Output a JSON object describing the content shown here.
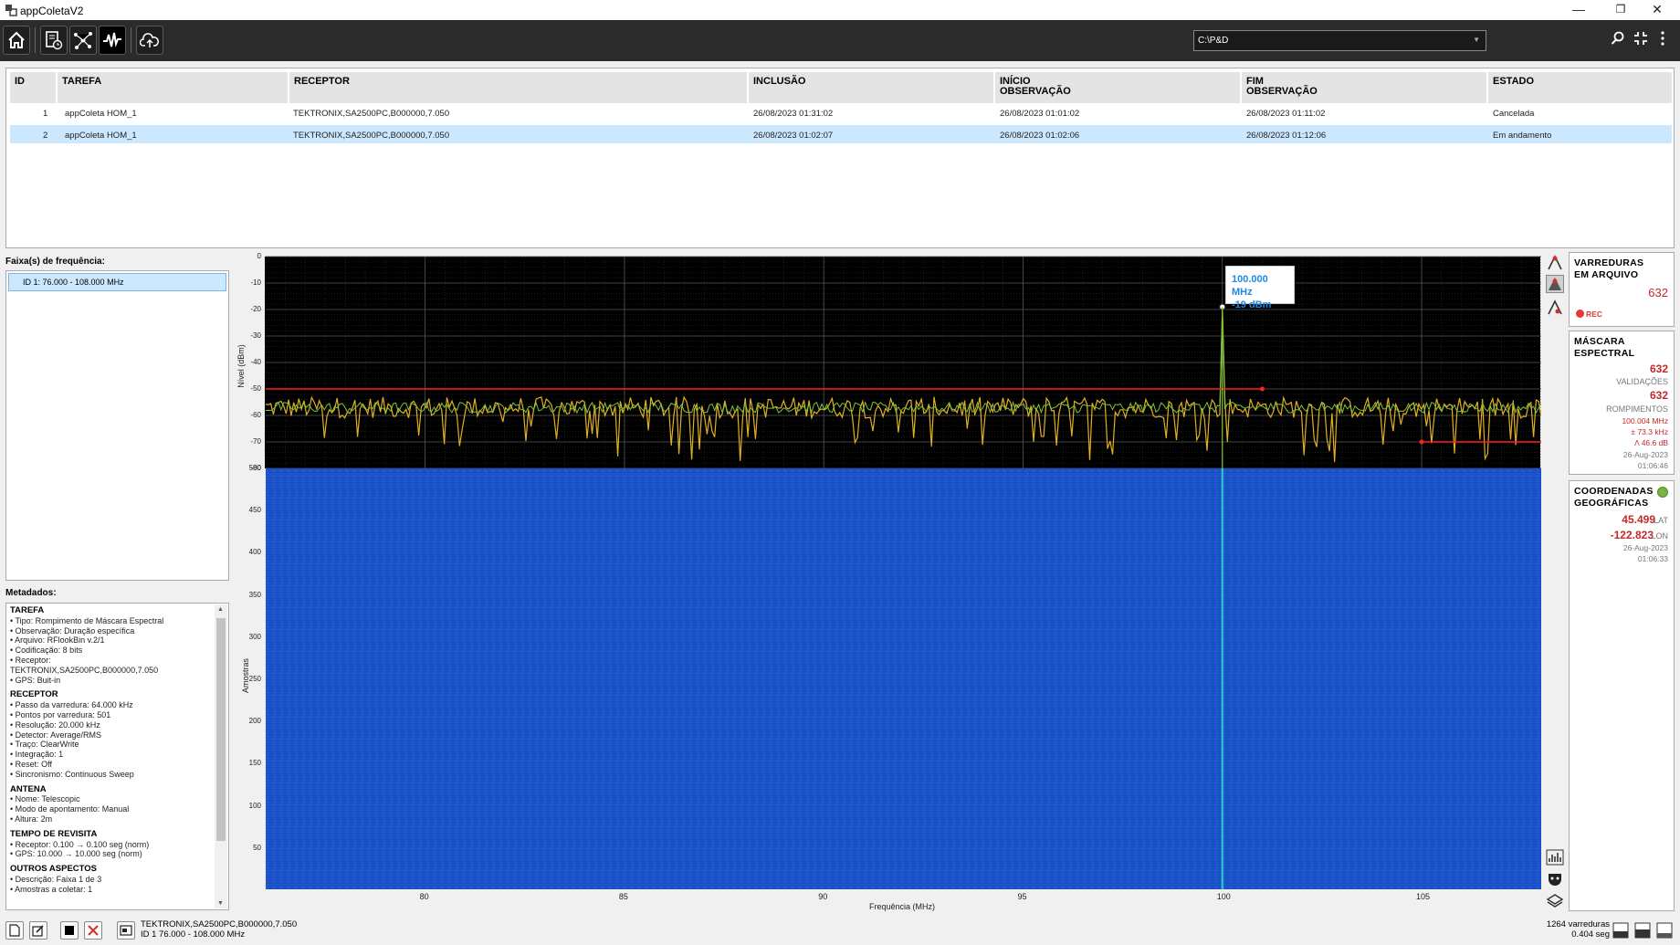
{
  "window": {
    "title": "appColetaV2",
    "controls": [
      "—",
      "❐",
      "✕"
    ]
  },
  "toolbar": {
    "path": "C:\\P&D"
  },
  "table": {
    "headers": [
      "ID",
      "TAREFA",
      "RECEPTOR",
      "INCLUSÃO",
      "INÍCIO\nOBSERVAÇÃO",
      "FIM\nOBSERVAÇÃO",
      "ESTADO"
    ],
    "rows": [
      [
        "1",
        "appColeta HOM_1",
        "TEKTRONIX,SA2500PC,B000000,7.050",
        "26/08/2023 01:31:02",
        "26/08/2023 01:01:02",
        "26/08/2023 01:11:02",
        "Cancelada"
      ],
      [
        "2",
        "appColeta HOM_1",
        "TEKTRONIX,SA2500PC,B000000,7.050",
        "26/08/2023 01:02:07",
        "26/08/2023 01:02:06",
        "26/08/2023 01:12:06",
        "Em andamento"
      ]
    ]
  },
  "left": {
    "faixa_label": "Faixa(s) de frequência:",
    "faixa_item": "ID 1: 76.000 - 108.000 MHz",
    "meta_label": "Metadados:",
    "meta": [
      {
        "title": "TAREFA",
        "lines": [
          "• Tipo: Rompimento de Máscara Espectral",
          "• Observação: Duração específica",
          "• Arquivo: RFlookBin v.2/1",
          "• Codificação: 8 bits",
          "• Receptor:",
          "TEKTRONIX,SA2500PC,B000000,7.050",
          "• GPS: Buit-in"
        ]
      },
      {
        "title": "RECEPTOR",
        "lines": [
          "• Passo da varredura: 64.000 kHz",
          "• Pontos por varredura: 501",
          "• Resolução: 20.000 kHz",
          "• Detector: Average/RMS",
          "• Traço: ClearWrite",
          "• Integração: 1",
          "• Reset: Off",
          "• Sincronismo: Continuous Sweep"
        ]
      },
      {
        "title": "ANTENA",
        "lines": [
          "• Nome: Telescopic",
          "• Modo de apontamento: Manual",
          "• Altura: 2m"
        ]
      },
      {
        "title": "TEMPO DE REVISITA",
        "lines": [
          "• Receptor: 0.100 → 0.100 seg (norm)",
          "• GPS: 10.000 → 10.000 seg (norm)"
        ]
      },
      {
        "title": "OUTROS ASPECTOS",
        "lines": [
          "• Descrição: Faixa 1 de 3",
          "• Amostras a coletar: 1"
        ]
      }
    ]
  },
  "chart": {
    "tooltip_freq": "100.000  MHz",
    "tooltip_level": "-19  dBm",
    "spectrum_ylabel": "Nível (dBm)",
    "waterfall_ylabel": "Amostras",
    "xlabel": "Frequência (MHz)"
  },
  "chart_data": [
    {
      "type": "line",
      "ylabel": "Nível (dBm)",
      "xlabel": "Frequência (MHz)",
      "xlim": [
        76,
        108
      ],
      "ylim": [
        -80,
        0
      ],
      "yticks": [
        "0",
        "-10",
        "-20",
        "-30",
        "-40",
        "-50",
        "-60",
        "-70",
        "-80"
      ],
      "xticks": [
        "80",
        "85",
        "90",
        "95",
        "100",
        "105"
      ],
      "series": [
        {
          "color": "#e0b020",
          "noise_floor": -57,
          "peak": {
            "x": 100.0,
            "y": -19
          }
        },
        {
          "color": "#7ec23a",
          "noise_floor": -57
        }
      ],
      "mask": {
        "color": "#ff2020",
        "segments": [
          {
            "x": [
              76,
              101
            ],
            "y": -50
          },
          {
            "x": [
              105,
              108
            ],
            "y": -70
          }
        ]
      },
      "marker": {
        "x": 100.0,
        "y": -19
      }
    },
    {
      "type": "heatmap",
      "ylabel": "Amostras",
      "yticks": [
        "500",
        "450",
        "400",
        "350",
        "300",
        "250",
        "200",
        "150",
        "100",
        "50"
      ],
      "xticks": [
        "80",
        "85",
        "90",
        "95",
        "100",
        "105"
      ],
      "xlim": [
        76,
        108
      ],
      "ylim": [
        0,
        500
      ],
      "highlight_x": 100.0
    }
  ],
  "panels": {
    "varreduras": {
      "title1": "VARREDURAS",
      "title2": "EM ARQUIVO",
      "count": "632",
      "rec": "REC"
    },
    "mascara": {
      "title1": "MÁSCARA",
      "title2": "ESPECTRAL",
      "validacoes": "632",
      "validacoes_label": "VALIDAÇÕES",
      "rompimentos": "632",
      "rompimentos_label": "ROMPIMENTOS",
      "freq": "100.004 MHz",
      "bw": "± 73.3 kHz",
      "delta": "Λ 46.6 dB",
      "date": "26-Aug-2023",
      "time": "01:06:46"
    },
    "coord": {
      "title1": "COORDENADAS",
      "title2": "GEOGRÁFICAS",
      "lat": "45.499",
      "lat_label": "LAT",
      "lon": "-122.823",
      "lon_label": "LON",
      "date": "26-Aug-2023",
      "time": "01:06:33"
    }
  },
  "status": {
    "receptor": "TEKTRONIX,SA2500PC,B000000,7.050",
    "faixa": "ID 1  76.000 - 108.000 MHz",
    "varreduras": "1264 varreduras",
    "seg": "0.404 seg"
  }
}
